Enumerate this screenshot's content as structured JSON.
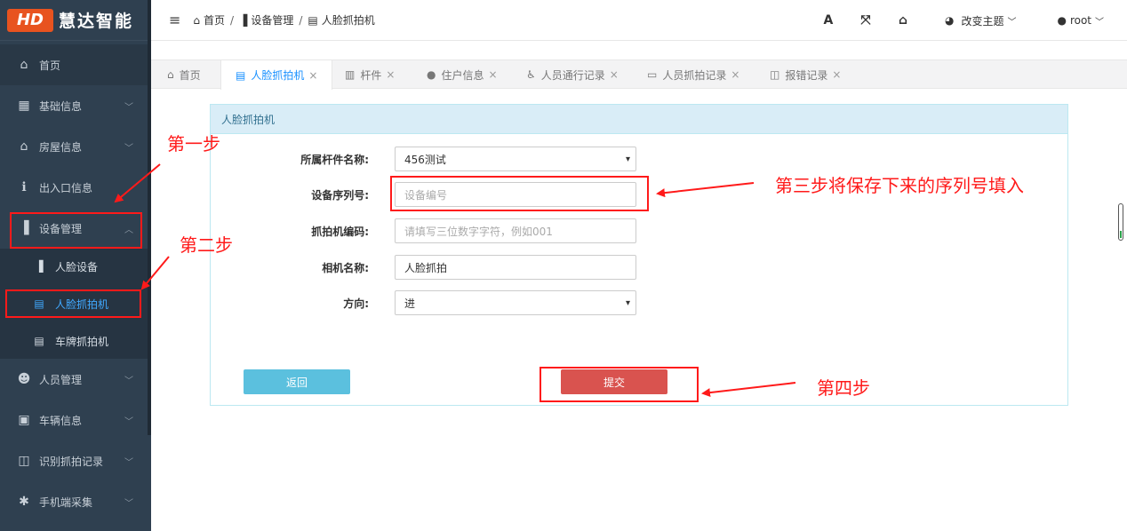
{
  "logo": {
    "mark": "HD",
    "name": "慧达智能"
  },
  "sidebar": {
    "items": [
      {
        "label": "首页",
        "icon": "home-icon"
      },
      {
        "label": "基础信息",
        "icon": "building-icon"
      },
      {
        "label": "房屋信息",
        "icon": "home-icon"
      },
      {
        "label": "出入口信息",
        "icon": "info-icon"
      },
      {
        "label": "设备管理",
        "icon": "door-icon"
      },
      {
        "label": "人员管理",
        "icon": "users-icon"
      },
      {
        "label": "车辆信息",
        "icon": "bus-icon"
      },
      {
        "label": "识别抓拍记录",
        "icon": "bookmark-icon"
      },
      {
        "label": "手机端采集",
        "icon": "bug-icon"
      }
    ],
    "submenu": [
      {
        "label": "人脸设备"
      },
      {
        "label": "人脸抓拍机"
      },
      {
        "label": "车牌抓拍机"
      }
    ]
  },
  "header": {
    "breadcrumb": [
      "首页",
      "设备管理",
      "人脸抓拍机"
    ],
    "theme_label": "改变主题",
    "user": "root"
  },
  "tabs": [
    {
      "label": "首页"
    },
    {
      "label": "人脸抓拍机"
    },
    {
      "label": "杆件"
    },
    {
      "label": "住户信息"
    },
    {
      "label": "人员通行记录"
    },
    {
      "label": "人员抓拍记录"
    },
    {
      "label": "报错记录"
    }
  ],
  "form": {
    "title": "人脸抓拍机",
    "fields": [
      {
        "label": "所属杆件名称:",
        "value": "456测试"
      },
      {
        "label": "设备序列号:",
        "placeholder": "设备编号"
      },
      {
        "label": "抓拍机编码:",
        "placeholder": "请填写三位数字字符，例如001"
      },
      {
        "label": "相机名称:",
        "value": "人脸抓拍"
      },
      {
        "label": "方向:",
        "value": "进"
      }
    ],
    "back_label": "返回",
    "submit_label": "提交"
  },
  "annotations": {
    "step1": "第一步",
    "step2": "第二步",
    "step3": "第三步将保存下来的序列号填入",
    "step4": "第四步",
    "color": "#ff1a1a"
  },
  "colors": {
    "sidebar_bg": "#2f4050",
    "active_blue": "#1890ff",
    "submit_red": "#d9534f",
    "back_blue": "#5bc0de",
    "panel_head": "#d9edf7"
  }
}
